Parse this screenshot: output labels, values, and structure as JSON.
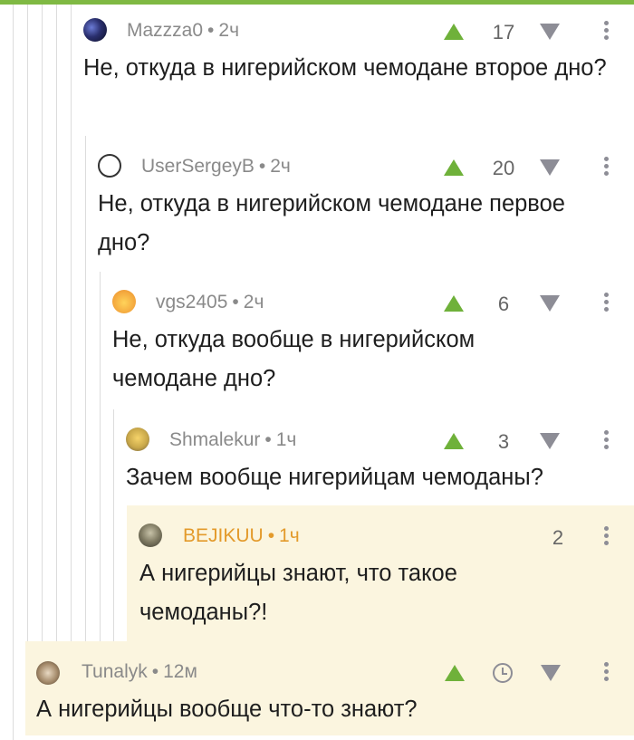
{
  "colors": {
    "accent_green": "#6fb13a",
    "icon_gray": "#8d8d96",
    "highlight_bg": "#fbf5df",
    "author_orange": "#e39a2b"
  },
  "comments": [
    {
      "author": "Mazzza0",
      "time": "2ч",
      "score": "17",
      "text": "Не, откуда в нигерийском чемодане второе дно?",
      "avatar_icon": "galaxy-avatar-icon"
    },
    {
      "author": "UserSergeyB",
      "time": "2ч",
      "score": "20",
      "text": "Не, откуда в нигерийском чемодане первое дно?",
      "avatar_icon": "wifi-avatar-icon"
    },
    {
      "author": "vgs2405",
      "time": "2ч",
      "score": "6",
      "text": "Не, откуда вообще в нигерийском чемодане дно?",
      "avatar_icon": "emoji-avatar-icon"
    },
    {
      "author": "Shmalekur",
      "time": "1ч",
      "score": "3",
      "text": "Зачем вообще нигерийцам чемоданы?",
      "avatar_icon": "cartoon-avatar-icon"
    },
    {
      "author": "BEJIKUU",
      "time": "1ч",
      "score": "2",
      "text": "А нигерийцы знают, что такое чемоданы?!",
      "avatar_icon": "photo-avatar-icon"
    },
    {
      "author": "Tunalyk",
      "time": "12м",
      "score": "",
      "text": "А нигерийцы вообще что-то знают?",
      "avatar_icon": "cat-avatar-icon"
    }
  ]
}
